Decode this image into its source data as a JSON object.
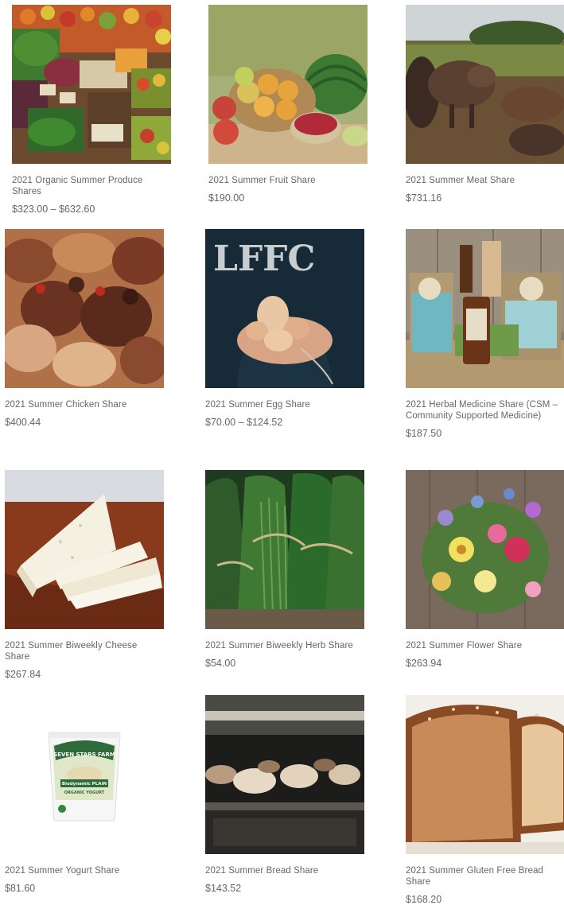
{
  "products": [
    {
      "title": "2021 Organic Summer Produce Shares",
      "price": "$323.00 – $632.60",
      "image": "farmers-market-produce-photo"
    },
    {
      "title": "2021 Summer Fruit Share",
      "price": "$190.00",
      "image": "fruit-basket-photo"
    },
    {
      "title": "2021 Summer Meat Share",
      "price": "$731.16",
      "image": "pigs-in-field-photo"
    },
    {
      "title": "2021 Summer Chicken Share",
      "price": "$400.44",
      "image": "chickens-photo"
    },
    {
      "title": "2021 Summer Egg Share",
      "price": "$70.00 – $124.52",
      "image": "eggs-in-hands-photo"
    },
    {
      "title": "2021 Herbal Medicine Share (CSM – Community Supported Medicine)",
      "price": "$187.50",
      "image": "herbal-medicine-bottles-photo"
    },
    {
      "title": "2021 Summer Biweekly Cheese Share",
      "price": "$267.84",
      "image": "cheese-wedge-photo"
    },
    {
      "title": "2021 Summer Biweekly Herb Share",
      "price": "$54.00",
      "image": "herb-bundles-photo"
    },
    {
      "title": "2021 Summer Flower Share",
      "price": "$263.94",
      "image": "flower-bouquet-photo"
    },
    {
      "title": "2021 Summer Yogurt Share",
      "price": "$81.60",
      "image": "yogurt-tub-photo"
    },
    {
      "title": "2021 Summer Bread Share",
      "price": "$143.52",
      "image": "bread-oven-photo"
    },
    {
      "title": "2021 Summer Gluten Free Bread Share",
      "price": "$168.20",
      "image": "gluten-free-bread-photo"
    }
  ],
  "yogurt_label": {
    "brand": "SEVEN STARS FARM",
    "variety": "Biodynamic PLAIN",
    "type": "ORGANIC YOGURT"
  },
  "egg_shirt_text": "LFFC",
  "colors": {
    "text": "#666666",
    "background": "#ffffff"
  }
}
